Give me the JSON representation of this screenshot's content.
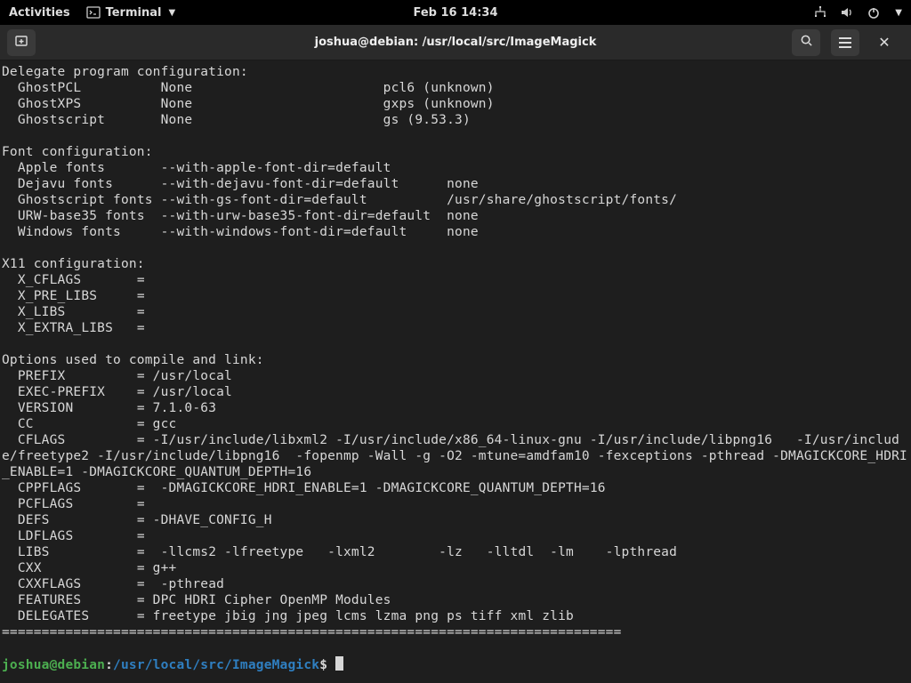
{
  "panel": {
    "activities": "Activities",
    "app_label": "Terminal",
    "clock": "Feb 16  14:34"
  },
  "window": {
    "title": "joshua@debian: /usr/local/src/ImageMagick"
  },
  "terminal": {
    "delegate_header": "Delegate program configuration:",
    "delegate_rows": [
      {
        "name": "GhostPCL",
        "opt": "None",
        "val": "pcl6 (unknown)"
      },
      {
        "name": "GhostXPS",
        "opt": "None",
        "val": "gxps (unknown)"
      },
      {
        "name": "Ghostscript",
        "opt": "None",
        "val": "gs (9.53.3)"
      }
    ],
    "font_header": "Font configuration:",
    "font_rows": [
      {
        "name": "Apple fonts",
        "opt": "--with-apple-font-dir=default",
        "val": ""
      },
      {
        "name": "Dejavu fonts",
        "opt": "--with-dejavu-font-dir=default",
        "val": "none"
      },
      {
        "name": "Ghostscript fonts",
        "opt": "--with-gs-font-dir=default",
        "val": "/usr/share/ghostscript/fonts/"
      },
      {
        "name": "URW-base35 fonts",
        "opt": "--with-urw-base35-font-dir=default",
        "val": "none"
      },
      {
        "name": "Windows fonts",
        "opt": "--with-windows-font-dir=default",
        "val": "none"
      }
    ],
    "x11_header": "X11 configuration:",
    "x11_rows": [
      {
        "name": "X_CFLAGS",
        "val": ""
      },
      {
        "name": "X_PRE_LIBS",
        "val": ""
      },
      {
        "name": "X_LIBS",
        "val": ""
      },
      {
        "name": "X_EXTRA_LIBS",
        "val": ""
      }
    ],
    "opts_header": "Options used to compile and link:",
    "opts_rows": [
      {
        "name": "PREFIX",
        "val": "/usr/local"
      },
      {
        "name": "EXEC-PREFIX",
        "val": "/usr/local"
      },
      {
        "name": "VERSION",
        "val": "7.1.0-63"
      },
      {
        "name": "CC",
        "val": "gcc"
      },
      {
        "name": "CFLAGS",
        "val": "-I/usr/include/libxml2 -I/usr/include/x86_64-linux-gnu -I/usr/include/libpng16   -I/usr/include/freetype2 -I/usr/include/libpng16  -fopenmp -Wall -g -O2 -mtune=amdfam10 -fexceptions -pthread -DMAGICKCORE_HDRI_ENABLE=1 -DMAGICKCORE_QUANTUM_DEPTH=16"
      },
      {
        "name": "CPPFLAGS",
        "val": " -DMAGICKCORE_HDRI_ENABLE=1 -DMAGICKCORE_QUANTUM_DEPTH=16"
      },
      {
        "name": "PCFLAGS",
        "val": ""
      },
      {
        "name": "DEFS",
        "val": "-DHAVE_CONFIG_H"
      },
      {
        "name": "LDFLAGS",
        "val": ""
      },
      {
        "name": "LIBS",
        "val": " -llcms2 -lfreetype   -lxml2        -lz   -lltdl  -lm    -lpthread"
      },
      {
        "name": "CXX",
        "val": "g++"
      },
      {
        "name": "CXXFLAGS",
        "val": " -pthread"
      },
      {
        "name": "FEATURES",
        "val": "DPC HDRI Cipher OpenMP Modules"
      },
      {
        "name": "DELEGATES",
        "val": "freetype jbig jng jpeg lcms lzma png ps tiff xml zlib"
      }
    ],
    "separator": "==============================================================================",
    "prompt": {
      "user": "joshua@debian",
      "colon": ":",
      "path": "/usr/local/src/ImageMagick",
      "dollar": "$ "
    }
  }
}
